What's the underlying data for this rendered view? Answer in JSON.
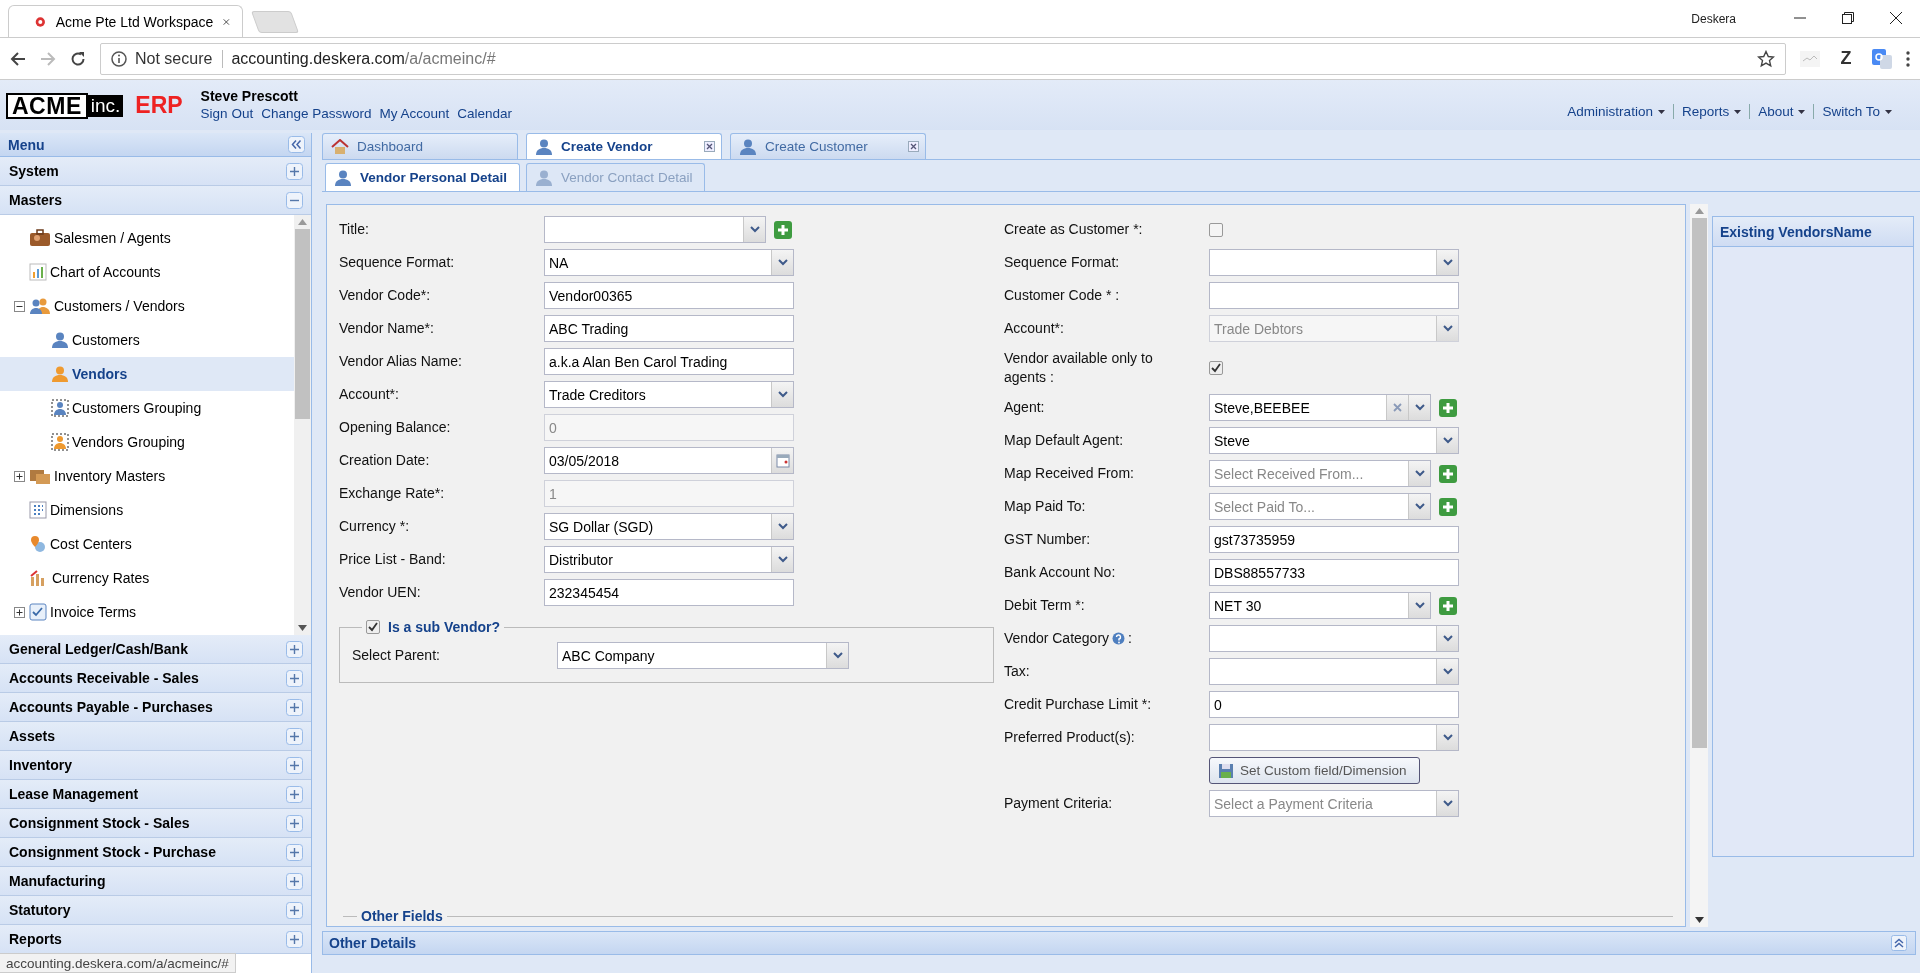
{
  "browser": {
    "tab_title": "Acme Pte Ltd Workspace",
    "security": "Not secure",
    "url_host": "accounting.deskera.com",
    "url_path": "/a/acmeinc/#",
    "extension_label": "Z",
    "profile": "Deskera"
  },
  "header": {
    "logo_main": "ACME",
    "logo_suffix": "inc.",
    "logo_product": "ERP",
    "user": "Steve Prescott",
    "links": [
      "Sign Out",
      "Change Password",
      "My Account",
      "Calendar"
    ],
    "menus": [
      "Administration",
      "Reports",
      "About",
      "Switch To"
    ]
  },
  "sidebar": {
    "title": "Menu",
    "sections": [
      {
        "label": "System",
        "expanded": false
      },
      {
        "label": "Masters",
        "expanded": true,
        "children": [
          {
            "label": "Salesmen / Agents",
            "selected": false
          },
          {
            "label": "Chart of Accounts",
            "selected": false
          },
          {
            "label": "Customers / Vendors",
            "selected": false,
            "expanded": true,
            "children": [
              {
                "label": "Customers",
                "selected": false
              },
              {
                "label": "Vendors",
                "selected": true
              },
              {
                "label": "Customers Grouping",
                "selected": false
              },
              {
                "label": "Vendors Grouping",
                "selected": false
              }
            ]
          },
          {
            "label": "Inventory Masters",
            "selected": false,
            "expanded": false
          },
          {
            "label": "Dimensions",
            "selected": false
          },
          {
            "label": "Cost Centers",
            "selected": false
          },
          {
            "label": "Currency Rates",
            "selected": false
          },
          {
            "label": "Invoice Terms",
            "selected": false,
            "expanded": false
          }
        ]
      },
      {
        "label": "General Ledger/Cash/Bank",
        "expanded": false
      },
      {
        "label": "Accounts Receivable - Sales",
        "expanded": false
      },
      {
        "label": "Accounts Payable - Purchases",
        "expanded": false
      },
      {
        "label": "Assets",
        "expanded": false
      },
      {
        "label": "Inventory",
        "expanded": false
      },
      {
        "label": "Lease Management",
        "expanded": false
      },
      {
        "label": "Consignment Stock - Sales",
        "expanded": false
      },
      {
        "label": "Consignment Stock - Purchase",
        "expanded": false
      },
      {
        "label": "Manufacturing",
        "expanded": false
      },
      {
        "label": "Statutory",
        "expanded": false
      },
      {
        "label": "Reports",
        "expanded": false
      }
    ]
  },
  "tabs": [
    {
      "label": "Dashboard",
      "selected": false,
      "closable": false
    },
    {
      "label": "Create Vendor",
      "selected": true,
      "closable": true
    },
    {
      "label": "Create Customer",
      "selected": false,
      "closable": true
    }
  ],
  "subtabs": [
    {
      "label": "Vendor Personal Detail",
      "selected": true
    },
    {
      "label": "Vendor Contact Detail",
      "selected": false
    }
  ],
  "form": {
    "left": [
      {
        "label": "Title:",
        "kind": "select",
        "add": true,
        "disabled": false
      },
      {
        "label": "Sequence Format:",
        "kind": "select",
        "value": "NA",
        "disabled": false
      },
      {
        "label": "Vendor Code*:",
        "kind": "text",
        "value": "Vendor00365",
        "disabled": false
      },
      {
        "label": "Vendor Name*:",
        "kind": "text",
        "value": "ABC Trading",
        "disabled": false
      },
      {
        "label": "Vendor Alias Name:",
        "kind": "text",
        "value": "a.k.a Alan Ben Carol Trading",
        "disabled": false
      },
      {
        "label": "Account*:",
        "kind": "select",
        "value": "Trade Creditors",
        "disabled": false
      },
      {
        "label": "Opening Balance:",
        "kind": "text",
        "value": "0",
        "disabled": true
      },
      {
        "label": "Creation Date:",
        "kind": "date",
        "value": "03/05/2018"
      },
      {
        "label": "Exchange Rate*:",
        "kind": "text",
        "value": "1",
        "disabled": true
      },
      {
        "label": "Currency *:",
        "kind": "select",
        "value": "SG Dollar (SGD)",
        "disabled": false
      },
      {
        "label": "Price List - Band:",
        "kind": "select",
        "value": "Distributor",
        "disabled": false
      },
      {
        "label": "Vendor UEN:",
        "kind": "text",
        "value": "232345454",
        "disabled": false
      }
    ],
    "sub_vendor": {
      "label": "Is a sub Vendor?",
      "checked": true,
      "parent_label": "Select Parent:",
      "parent_value": "ABC Company"
    },
    "right": [
      {
        "label": "Create as Customer *:",
        "kind": "checkbox",
        "checked": false
      },
      {
        "label": "Sequence Format:",
        "kind": "select",
        "disabled": false
      },
      {
        "label": "Customer Code * :",
        "kind": "text",
        "disabled": false
      },
      {
        "label": "Account*:",
        "kind": "select",
        "value": "Trade Debtors",
        "disabled": true
      },
      {
        "label": "Vendor available only to agents :",
        "kind": "checkbox",
        "checked": true
      },
      {
        "label": "Agent:",
        "kind": "multiselect",
        "value": "Steve,BEEBEE",
        "add": true
      },
      {
        "label": "Map Default Agent:",
        "kind": "select",
        "value": "Steve",
        "disabled": false
      },
      {
        "label": "Map Received From:",
        "kind": "select",
        "placeholder": "Select Received From...",
        "add": true,
        "disabled": false
      },
      {
        "label": "Map Paid To:",
        "kind": "select",
        "placeholder": "Select Paid To...",
        "add": true,
        "disabled": false
      },
      {
        "label": "GST Number:",
        "kind": "text",
        "value": "gst73735959",
        "disabled": false
      },
      {
        "label": "Bank Account No:",
        "kind": "text",
        "value": "DBS88557733",
        "disabled": false
      },
      {
        "label": "Debit Term *:",
        "kind": "select",
        "value": "NET 30",
        "add": true,
        "disabled": false
      },
      {
        "label": "Vendor Category",
        "help": true,
        "label_suffix": ":",
        "kind": "select",
        "disabled": false
      },
      {
        "label": "Tax:",
        "kind": "select",
        "disabled": false
      },
      {
        "label": "Credit Purchase Limit *:",
        "kind": "text",
        "value": "0",
        "disabled": false
      },
      {
        "label": "Preferred Product(s):",
        "kind": "select",
        "disabled": false
      },
      {
        "kind": "button",
        "value": "Set Custom field/Dimension"
      },
      {
        "label": "Payment Criteria:",
        "kind": "select",
        "placeholder": "Select a Payment Criteria",
        "disabled": false
      }
    ],
    "other_fields": "Other Fields"
  },
  "side_panel": {
    "title": "Existing VendorsName"
  },
  "other_details": "Other Details",
  "status_bubble": "accounting.deskera.com/a/acmeinc/#"
}
